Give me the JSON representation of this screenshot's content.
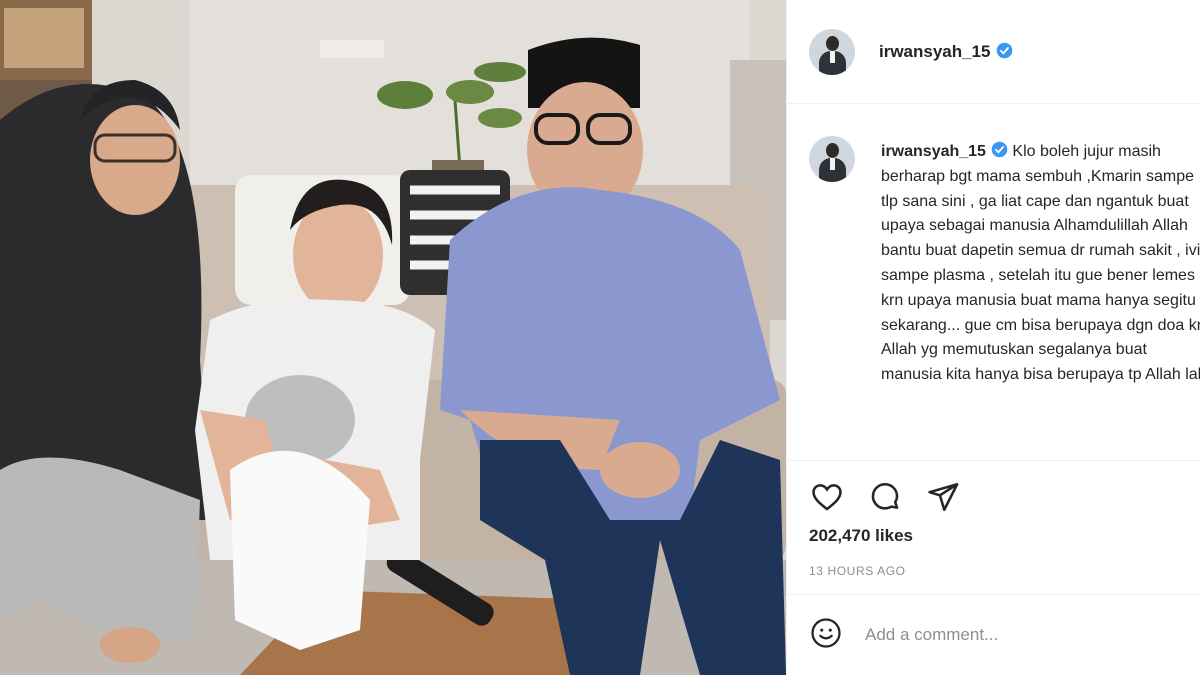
{
  "post": {
    "username": "irwansyah_15",
    "caption": "Klo boleh jujur masih berharap bgt mama sembuh ,Kmarin sampe tlp sana sini , ga liat cape dan ngantuk buat upaya sebagai manusia Alhamdulillah Allah bantu buat dapetin semua dr rumah sakit , ivig sampe plasma , setelah itu gue bener lemes krn upaya manusia buat mama hanya segitu , sekarang... gue cm bisa berupaya dgn doa krn Allah yg memutuskan segalanya buat manusia kita hanya bisa berupaya tp Allah lah",
    "likes": "202,470 likes",
    "time": "13 HOURS AGO",
    "comment_placeholder": "Add a comment..."
  },
  "icons": {
    "verified": "verified-badge-icon",
    "like": "heart-icon",
    "comment": "comment-bubble-icon",
    "share": "paper-plane-icon",
    "emoji": "smiley-icon"
  },
  "colors": {
    "verified": "#3897f0",
    "text": "#262626",
    "muted": "#8e8e8e",
    "border": "#efefef"
  }
}
